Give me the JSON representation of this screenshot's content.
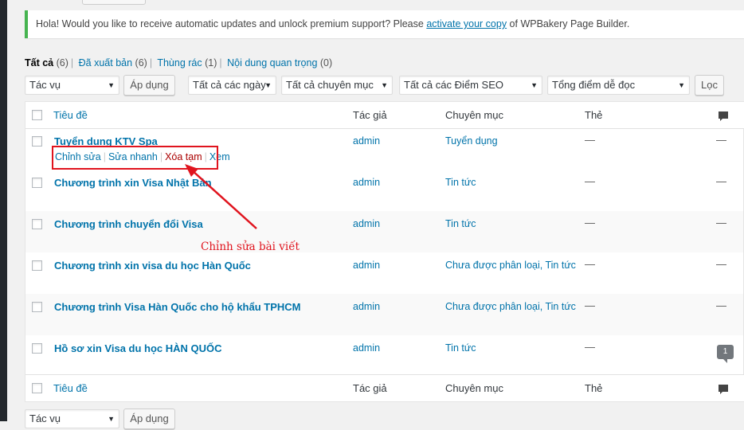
{
  "notice": {
    "text_before": "Hola! Would you like to receive automatic updates and unlock premium support? Please ",
    "link": "activate your copy",
    "text_after": " of WPBakery Page Builder."
  },
  "views": [
    {
      "label": "Tất cả",
      "count": "(6)",
      "current": true
    },
    {
      "label": "Đã xuất bản",
      "count": "(6)"
    },
    {
      "label": "Thùng rác",
      "count": "(1)"
    },
    {
      "label": "Nội dung quan trọng",
      "count": "(0)"
    }
  ],
  "filters": {
    "bulk_action": "Tác vụ",
    "apply": "Áp dụng",
    "dates": "Tất cả các ngày",
    "categories": "Tất cả chuyên mục",
    "seo": "Tất cả các Điểm SEO",
    "readability": "Tổng điểm dễ đọc",
    "filter_btn": "Lọc"
  },
  "columns": {
    "title": "Tiêu đề",
    "author": "Tác giả",
    "categories": "Chuyên mục",
    "tags": "Thẻ",
    "comments_icon": "comment-icon"
  },
  "row_actions": {
    "edit": "Chỉnh sửa",
    "quick_edit": "Sửa nhanh",
    "trash": "Xóa tạm",
    "view": "Xem"
  },
  "posts": [
    {
      "title": "Tuyển dụng KTV Spa",
      "author": "admin",
      "categories": "Tuyển dụng",
      "tags": "—",
      "comments": "—"
    },
    {
      "title": "Chương trình xin Visa Nhật Bản",
      "author": "admin",
      "categories": "Tin tức",
      "tags": "—",
      "comments": "—"
    },
    {
      "title": "Chương trình chuyển đổi Visa",
      "author": "admin",
      "categories": "Tin tức",
      "tags": "—",
      "comments": "—"
    },
    {
      "title": "Chương trình xin visa du học Hàn Quốc",
      "author": "admin",
      "categories": "Chưa được phân loại, Tin tức",
      "tags": "—",
      "comments": "—"
    },
    {
      "title": "Chương trình Visa Hàn Quốc cho hộ khẩu TPHCM",
      "author": "admin",
      "categories": "Chưa được phân loại, Tin tức",
      "tags": "—",
      "comments": "—"
    },
    {
      "title": "Hồ sơ xin Visa du học HÀN QUỐC",
      "author": "admin",
      "categories": "Tin tức",
      "tags": "—",
      "comments": "1"
    }
  ],
  "annotation": {
    "label": "Chỉnh sửa bài viết",
    "color": "#e0141e"
  },
  "bottom": {
    "bulk_action": "Tác vụ",
    "apply": "Áp dụng"
  }
}
